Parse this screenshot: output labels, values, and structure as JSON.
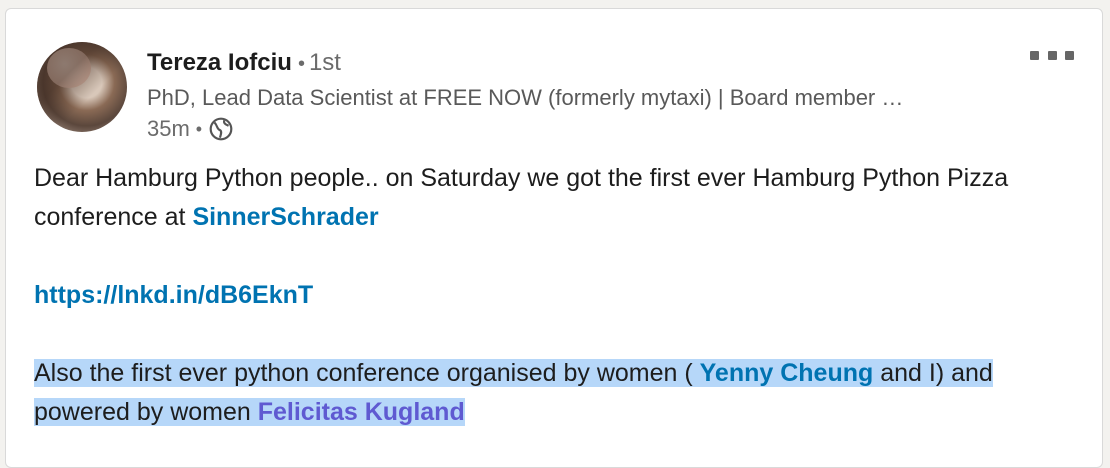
{
  "post": {
    "author": {
      "name": "Tereza Iofciu",
      "degree": "1st",
      "headline": "PhD, Lead Data Scientist at FREE NOW (formerly mytaxi) | Board member …",
      "time": "35m",
      "visibility_icon": "globe-icon",
      "avatar_icon": "profile-photo"
    },
    "menu_icon": "more-options-icon",
    "body": {
      "para1_text": "Dear Hamburg Python people.. on Saturday we got the first ever Hamburg Python Pizza conference at ",
      "para1_mention": "SinnerSchrader",
      "link": "https://lnkd.in/dB6EknT",
      "para3_text_a": "Also the first ever python conference organised by women ( ",
      "para3_mention1": "Yenny Cheung",
      "para3_text_b": " and I) and powered by women ",
      "para3_mention2": "Felicitas Kugland"
    },
    "colors": {
      "link": "#0073b1",
      "visited_mention": "#5f5ad1",
      "selection": "#b6d7f9",
      "text": "#1d1d1d",
      "muted": "#6b6b6b"
    }
  }
}
